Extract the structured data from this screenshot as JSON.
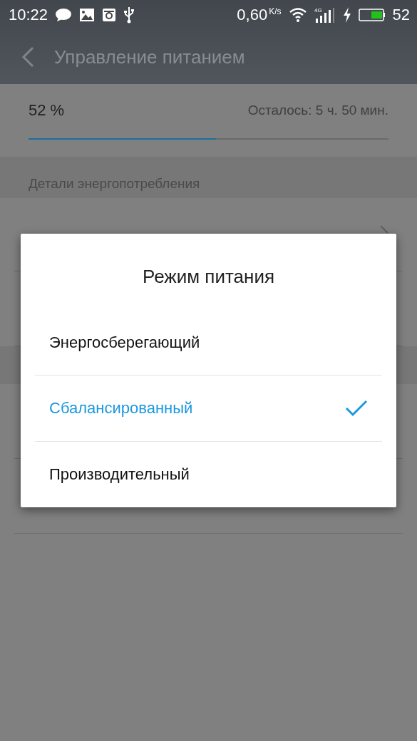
{
  "status_bar": {
    "time": "10:22",
    "speed": "0,60",
    "speed_unit": "K/s",
    "network": "4G",
    "battery": "52"
  },
  "header": {
    "title": "Управление питанием"
  },
  "battery": {
    "percent": "52 %",
    "remaining": "Осталось: 5 ч. 50 мин.",
    "level": 0.52
  },
  "section": {
    "title": "Детали энергопотребления"
  },
  "rows": [
    {
      "kind": "link"
    }
  ],
  "dialog": {
    "title": "Режим питания",
    "options": [
      {
        "label": "Энергосберегающий",
        "selected": false
      },
      {
        "label": "Сбалансированный",
        "selected": true
      },
      {
        "label": "Производительный",
        "selected": false
      }
    ]
  }
}
